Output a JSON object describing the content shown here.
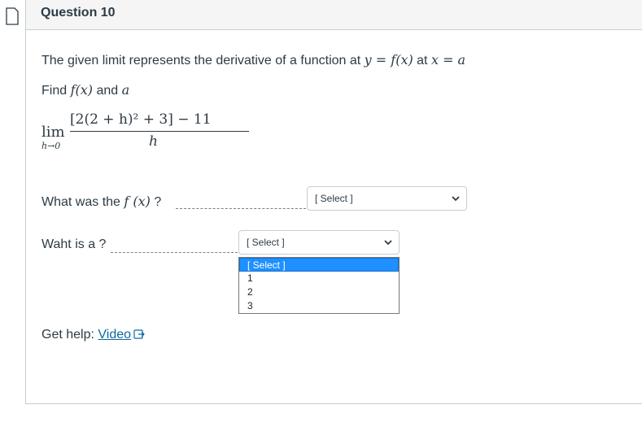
{
  "question": {
    "title": "Question 10",
    "prompt_text": "The given limit represents the derivative of a function at",
    "prompt_at": "at",
    "find_text": "Find",
    "find_and": "and",
    "math": {
      "y_eq_fx": "y = f(x)",
      "x_eq_a": "x = a",
      "fx": "f(x)",
      "a": "a",
      "lim": "lim",
      "lim_sub": "h→0",
      "numerator": "[2(2 + h)² + 3] − 11",
      "denominator": "h"
    }
  },
  "answers": [
    {
      "label_prefix": "What was the",
      "label_math": "f (x)",
      "label_suffix": "?",
      "selected": "[ Select ]"
    },
    {
      "label": "Waht is a ?",
      "selected": "[ Select ]",
      "options": [
        "[ Select ]",
        "1",
        "2",
        "3"
      ],
      "highlighted_index": 0
    }
  ],
  "help": {
    "prefix": "Get help:",
    "link_label": "Video"
  },
  "icons": {
    "flag": "bookmark-flag-icon",
    "chevron": "chevron-down-icon",
    "external": "external-link-icon"
  },
  "colors": {
    "link": "#0b6aa2",
    "highlight": "#1e90ff",
    "text": "#2d3b45"
  }
}
